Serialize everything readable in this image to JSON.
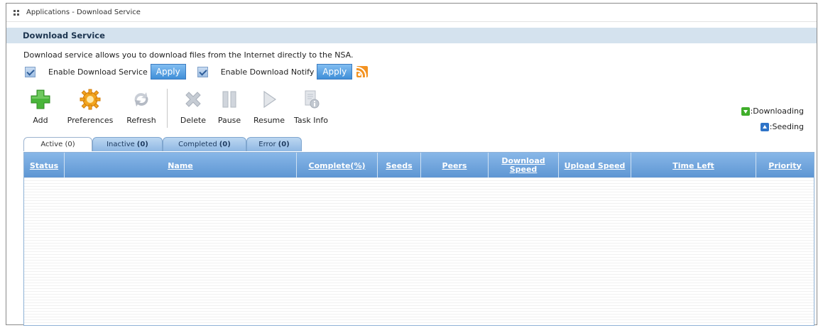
{
  "window": {
    "title": "Applications - Download Service"
  },
  "section": {
    "title": "Download Service"
  },
  "description": "Download service allows you to download files from the Internet directly to the NSA.",
  "options": {
    "enable_download_label": "Enable Download Service",
    "enable_download_checked": true,
    "apply_label": "Apply",
    "enable_notify_label": "Enable Download Notify",
    "enable_notify_checked": true,
    "apply2_label": "Apply"
  },
  "toolbar": {
    "add": "Add",
    "preferences": "Preferences",
    "refresh": "Refresh",
    "delete": "Delete",
    "pause": "Pause",
    "resume": "Resume",
    "task_info": "Task Info"
  },
  "legend": {
    "downloading": ":Downloading",
    "seeding": ":Seeding",
    "downloading_color": "#3fae2a",
    "seeding_color": "#2f74c8"
  },
  "tabs": [
    {
      "label": "Active",
      "count": "(0)"
    },
    {
      "label": "Inactive",
      "count": "(0)"
    },
    {
      "label": "Completed",
      "count": "(0)"
    },
    {
      "label": "Error",
      "count": "(0)"
    }
  ],
  "table": {
    "columns": [
      "Status",
      "Name",
      "Complete(%)",
      "Seeds",
      "Peers",
      "Download Speed",
      "Upload Speed",
      "Time Left",
      "Priority"
    ],
    "rows": []
  }
}
